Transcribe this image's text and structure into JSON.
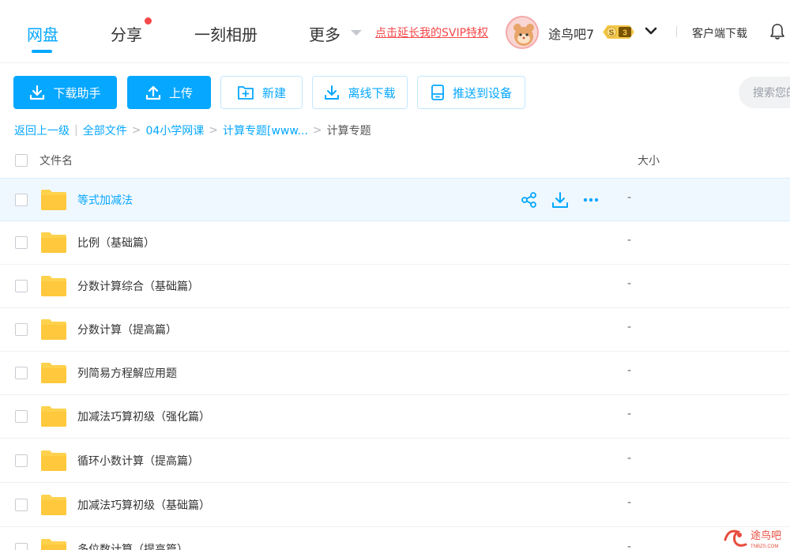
{
  "nav": {
    "tabs": [
      {
        "label": "网盘"
      },
      {
        "label": "分享"
      },
      {
        "label": "一刻相册"
      },
      {
        "label": "更多"
      }
    ],
    "svip_link": "点击延长我的SVIP特权",
    "username": "途鸟吧7",
    "badge_s": "S",
    "badge_level": "3",
    "client_download": "客户端下载"
  },
  "toolbar": {
    "download_helper": "下载助手",
    "upload": "上传",
    "new": "新建",
    "offline_download": "离线下载",
    "push_to_device": "推送到设备",
    "search_placeholder": "搜索您的"
  },
  "breadcrumb": {
    "back": "返回上一级",
    "items": [
      "全部文件",
      "04小学网课",
      "计算专题[www..."
    ],
    "current": "计算专题"
  },
  "table": {
    "col_name": "文件名",
    "col_size": "大小",
    "rows": [
      {
        "name": "等式加减法",
        "size": "-"
      },
      {
        "name": "比例（基础篇）",
        "size": "-"
      },
      {
        "name": "分数计算综合（基础篇）",
        "size": "-"
      },
      {
        "name": "分数计算（提高篇）",
        "size": "-"
      },
      {
        "name": "列简易方程解应用题",
        "size": "-"
      },
      {
        "name": "加减法巧算初级（强化篇）",
        "size": "-"
      },
      {
        "name": "循环小数计算（提高篇）",
        "size": "-"
      },
      {
        "name": "加减法巧算初级（基础篇）",
        "size": "-"
      },
      {
        "name": "多位数计算（提高篇）",
        "size": "-"
      }
    ]
  },
  "watermark": {
    "text": "途鸟吧",
    "sub": "TNBZS.COM"
  },
  "colors": {
    "accent": "#06a7ff",
    "red": "#f5484a",
    "folder": "#ffd24d"
  }
}
